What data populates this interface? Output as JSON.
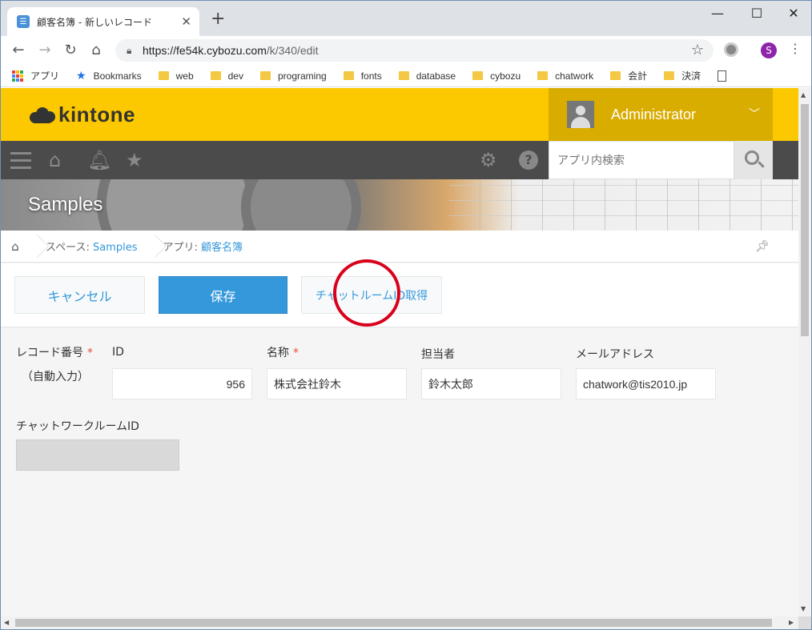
{
  "browser": {
    "tab_title": "顧客名簿 - 新しいレコード",
    "tab_close": "✕",
    "new_tab": "+",
    "url_host": "https://fe54k.cybozu.com",
    "url_path": "/k/340/edit",
    "profile_initial": "S"
  },
  "bookmarks": {
    "apps": "アプリ",
    "items": [
      "Bookmarks",
      "web",
      "dev",
      "programing",
      "fonts",
      "database",
      "cybozu",
      "chatwork",
      "会計",
      "決済"
    ]
  },
  "kintone": {
    "logo": "kintone",
    "user_name": "Administrator",
    "search_placeholder": "アプリ内検索",
    "space_title": "Samples"
  },
  "breadcrumb": {
    "space_prefix": "スペース:",
    "space_link": "Samples",
    "app_prefix": "アプリ:",
    "app_link": "顧客名簿"
  },
  "actions": {
    "cancel": "キャンセル",
    "save": "保存",
    "get_room_id": "チャットルームID取得"
  },
  "form": {
    "record_no_label": "レコード番号",
    "auto_input": "（自動入力）",
    "required_mark": "*",
    "id_label": "ID",
    "id_value": "956",
    "name_label": "名称",
    "name_value": "株式会社鈴木",
    "owner_label": "担当者",
    "owner_value": "鈴木太郎",
    "email_label": "メールアドレス",
    "email_value": "chatwork@tis2010.jp",
    "room_id_label": "チャットワークルームID",
    "room_id_value": ""
  },
  "colors": {
    "header_yellow": "#fcc800",
    "primary_blue": "#3498db",
    "annotation_red": "#d9001b"
  }
}
